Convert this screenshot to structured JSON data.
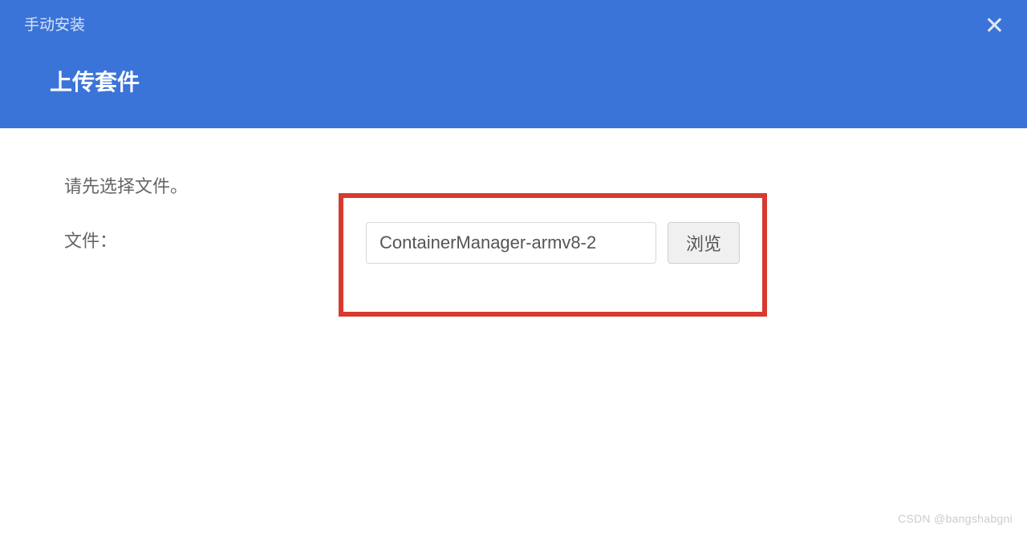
{
  "header": {
    "small_title": "手动安装",
    "main_title": "上传套件"
  },
  "content": {
    "instruction": "请先选择文件。",
    "file_label": "文件：",
    "file_value": "ContainerManager-armv8-2",
    "browse_label": "浏览"
  },
  "watermark": "CSDN @bangshabgni"
}
